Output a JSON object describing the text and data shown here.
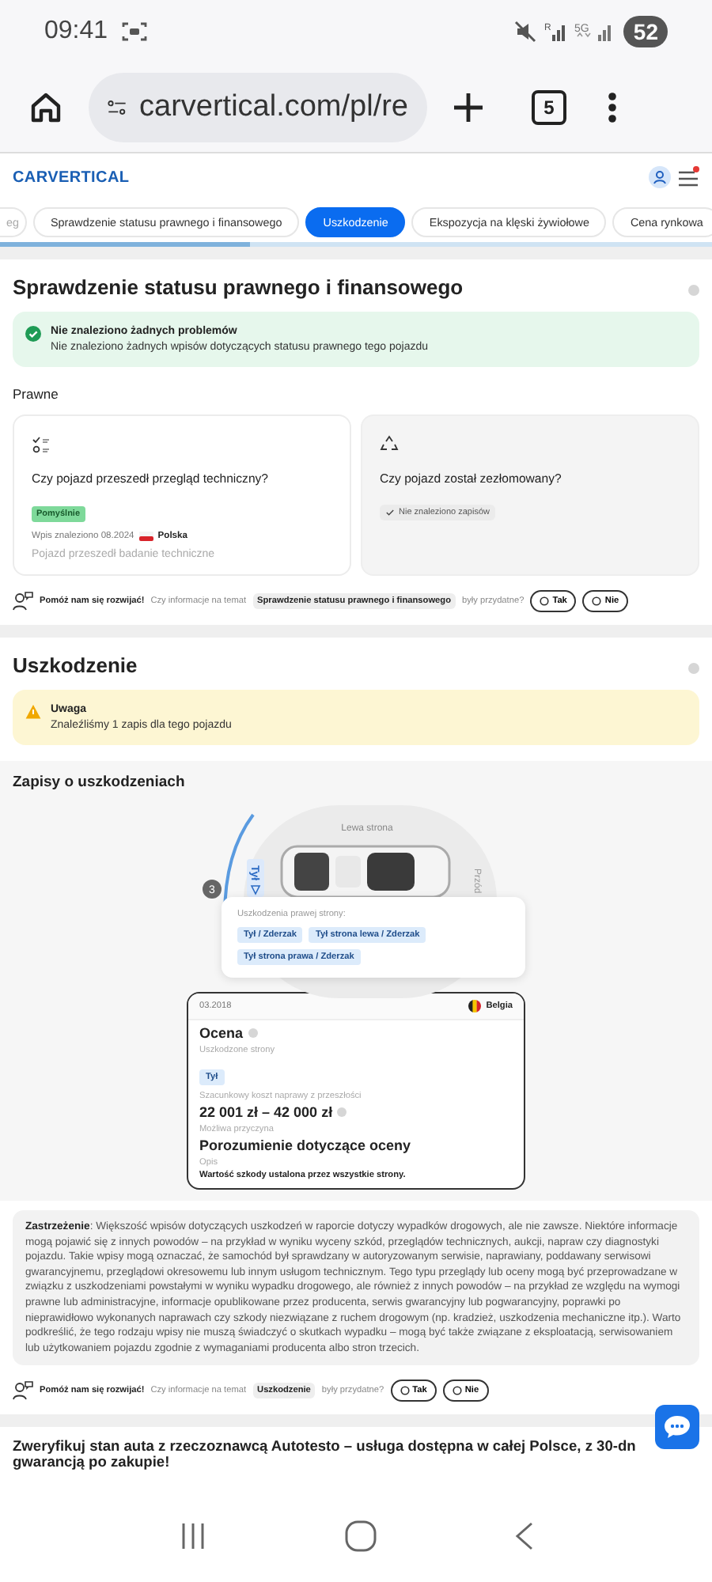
{
  "status_bar": {
    "time": "09:41",
    "roaming": "R",
    "network": "5G",
    "battery": "52"
  },
  "browser": {
    "url": "carvertical.com/pl/re",
    "tab_count": "5"
  },
  "site_header": {
    "logo": "CARVERTICAL",
    "notification": true
  },
  "tabs": [
    {
      "label": "eg",
      "selected": false
    },
    {
      "label": "Sprawdzenie statusu prawnego i finansowego",
      "selected": false
    },
    {
      "label": "Uszkodzenie",
      "selected": true
    },
    {
      "label": "Ekspozycja na klęski żywiołowe",
      "selected": false
    },
    {
      "label": "Cena rynkowa",
      "selected": false
    }
  ],
  "reading_progress": {
    "level": 0.35
  },
  "legal_section": {
    "title": "Sprawdzenie statusu prawnego i finansowego",
    "alert": {
      "kind": "success",
      "title": "Nie znaleziono żadnych problemów",
      "text": "Nie znaleziono żadnych wpisów dotyczących statusu prawnego tego pojazdu"
    },
    "group_label": "Prawne",
    "cards": [
      {
        "kind": "inspection",
        "question": "Czy pojazd przeszedł przegląd techniczny?",
        "badge": "Pomyślnie",
        "entry": "Wpis znaleziono 08.2024",
        "country": "Polska",
        "note": "Pojazd przeszedł badanie techniczne"
      },
      {
        "kind": "scrap",
        "question": "Czy pojazd został zezłomowany?",
        "chip": "Nie znaleziono zapisów"
      }
    ],
    "feedback": {
      "prompt": "Pomóż nam się rozwijać!",
      "question": "Czy informacje na temat",
      "topic": "Sprawdzenie statusu prawnego i finansowego",
      "suffix": "były przydatne?",
      "buttons": [
        "Tak",
        "Nie"
      ]
    }
  },
  "damage_section": {
    "title": "Uszkodzenie",
    "alert": {
      "kind": "warning",
      "title": "Uwaga",
      "text": "Znaleźliśmy 1 zapis dla tego pojazdu"
    },
    "records_title": "Zapisy o uszkodzeniach",
    "diagram": {
      "top_label": "Lewa strona",
      "right_label": "Przód",
      "left_label": "Tył",
      "badge": "3"
    },
    "popup": {
      "title": "Uszkodzenia prawej strony:",
      "tags": [
        "Tył / Zderzak",
        "Tył strona lewa / Zderzak",
        "Tył strona prawa / Zderzak"
      ]
    },
    "record": {
      "date": "03.2018",
      "country": "Belgia",
      "type": "Ocena",
      "sides_label": "Uszkodzone strony",
      "sides": [
        "Tył"
      ],
      "cost_label": "Szacunkowy koszt naprawy z przeszłości",
      "cost": "22 001 zł – 42 000 zł",
      "cause_label": "Możliwa przyczyna",
      "cause": "Porozumienie dotyczące oceny",
      "desc_label": "Opis",
      "desc": "Wartość szkody ustalona przez wszystkie strony."
    },
    "disclaimer": "**Zastrzeżenie**: Większość wpisów dotyczących uszkodzeń w raporcie dotyczy wypadków drogowych, ale nie zawsze. Niektóre informacje mogą pojawić się z innych powodów – na przykład w wyniku wyceny szkód, przeglądów technicznych, aukcji, napraw czy diagnostyki pojazdu. Takie wpisy mogą oznaczać, że samochód był sprawdzany w autoryzowanym serwisie, naprawiany, poddawany serwisowi gwarancyjnemu, przeglądowi okresowemu lub innym usługom technicznym. Tego typu przeglądy lub oceny mogą być przeprowadzane w związku z uszkodzeniami powstałymi w wyniku wypadku drogowego, ale również z innych powodów – na przykład ze względu na wymogi prawne lub administracyjne, informacje opublikowane przez producenta, serwis gwarancyjny lub pogwarancyjny, poprawki po nieprawidłowo wykonanych naprawach czy szkody niezwiązane z ruchem drogowym (np. kradzież, uszkodzenia mechaniczne itp.). Warto podkreślić, że tego rodzaju wpisy nie muszą świadczyć o skutkach wypadku – mogą być także związane z eksploatacją, serwisowaniem lub użytkowaniem pojazdu zgodnie z wymaganiami producenta albo stron trzecich.",
    "feedback": {
      "prompt": "Pomóż nam się rozwijać!",
      "question": "Czy informacje na temat",
      "topic": "Uszkodzenie",
      "suffix": "były przydatne?",
      "buttons": [
        "Tak",
        "Nie"
      ]
    }
  },
  "promo": {
    "lines": [
      "Zweryfikuj stan auta z rzeczoznawcą Autotesto – usługa dostępna w całej Polsce, z 30-dn",
      "gwarancją po zakupie!"
    ]
  }
}
